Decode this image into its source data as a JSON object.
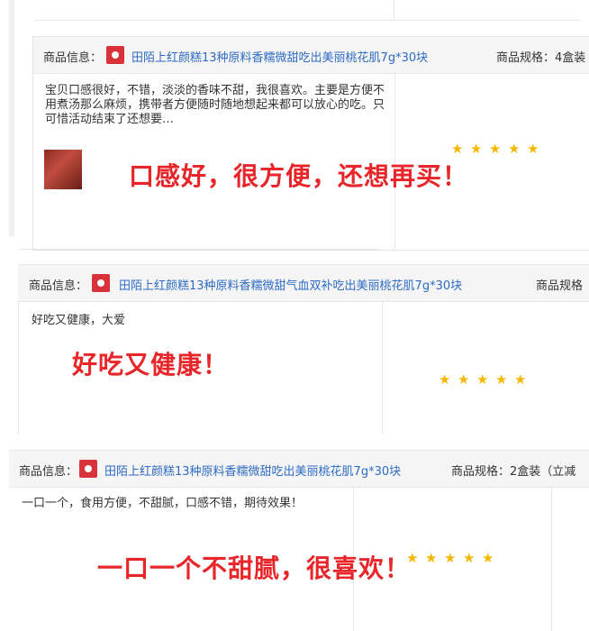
{
  "reviews": [
    {
      "product_info_label": "商品信息：",
      "product_title": "田陌上红颜糕13种原料香糯微甜吃出美丽桃花肌7g*30块",
      "spec_text": "商品规格：4盒装",
      "review_text": "宝贝口感很好，不错，淡淡的香味不甜，我很喜欢。主要是方便不用煮汤那么麻烦，携带者方便随时随地想起来都可以放心的吃。只可惜活动结束了还想要…",
      "overlay": "口感好，很方便，还想再买！",
      "rating": 5
    },
    {
      "product_info_label": "商品信息：",
      "product_title": "田陌上红颜糕13种原料香糯微甜气血双补吃出美丽桃花肌7g*30块",
      "spec_text": "商品规格",
      "review_text": "好吃又健康，大爱",
      "overlay": "好吃又健康！",
      "rating": 5
    },
    {
      "product_info_label": "商品信息：",
      "product_title": "田陌上红颜糕13种原料香糯微甜吃出美丽桃花肌7g*30块",
      "spec_text": "商品规格：2盒装（立减",
      "review_text": "一口一个，食用方便，不甜腻，口感不错，期待效果！",
      "overlay": "一口一个不甜腻，很喜欢！",
      "rating": 5
    }
  ],
  "star_glyph": "★",
  "colors": {
    "accent_red": "#e8262a",
    "link_blue": "#2d6bc5",
    "star": "#f5b800"
  }
}
